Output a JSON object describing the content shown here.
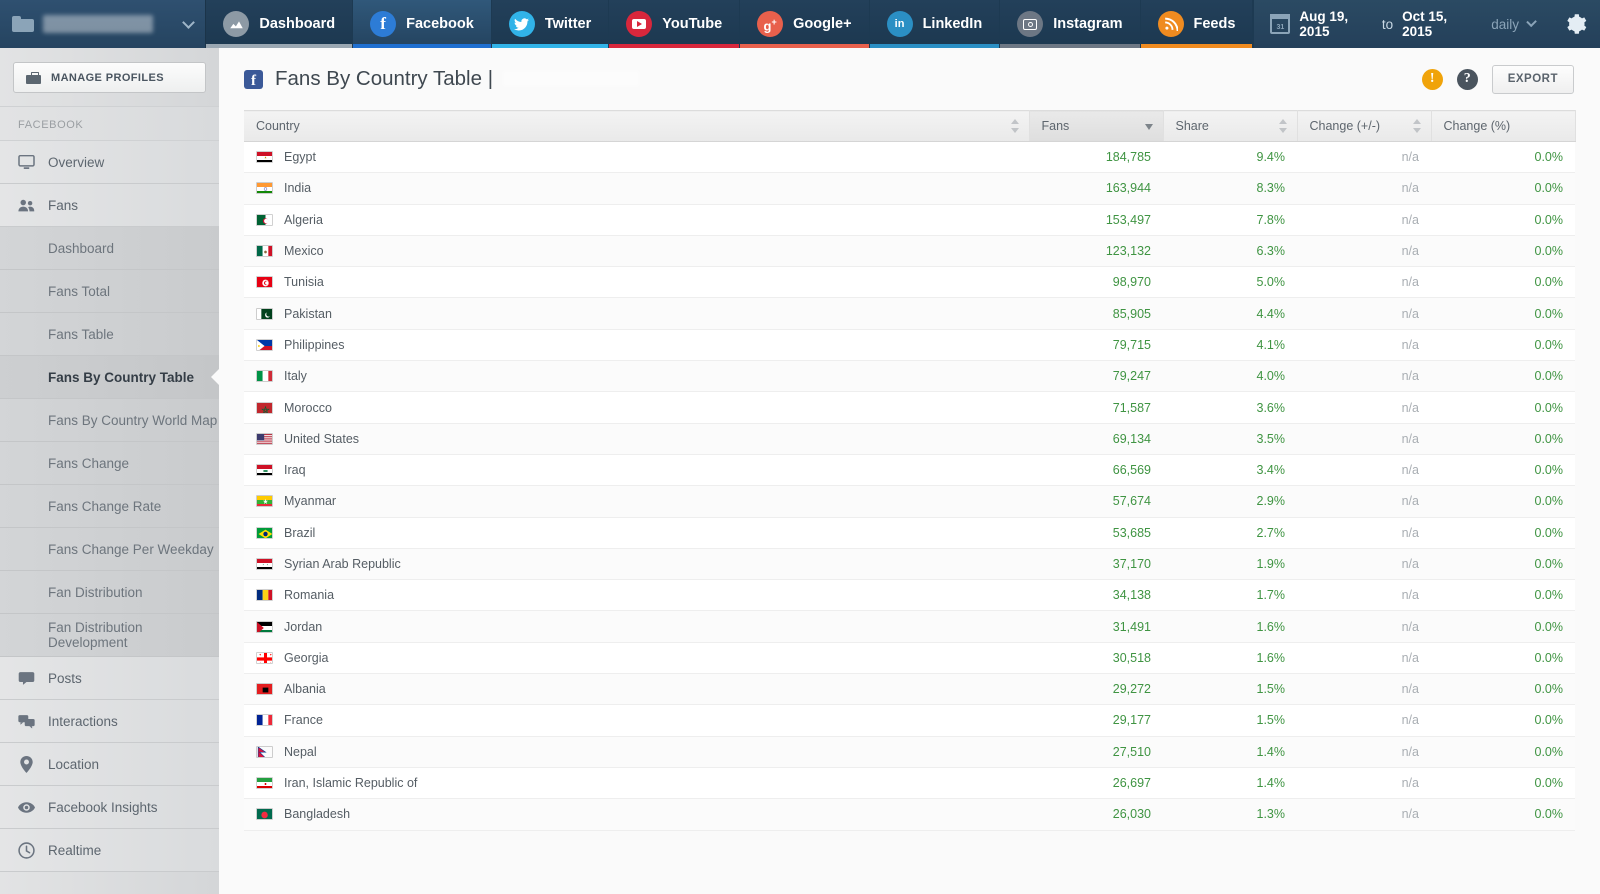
{
  "topbar": {
    "profile_name_redacted": true,
    "folder_icon": "folder-icon",
    "tabs": [
      {
        "label": "Dashboard",
        "icon": "chart-icon",
        "color": "#8d9aa5",
        "accent": "#9aa7b2",
        "active": false
      },
      {
        "label": "Facebook",
        "icon": "facebook-icon",
        "color": "#2d7cd6",
        "accent": "#1f6fd0",
        "active": true
      },
      {
        "label": "Twitter",
        "icon": "twitter-icon",
        "color": "#31b3e8",
        "accent": "#31b3e8",
        "active": false
      },
      {
        "label": "YouTube",
        "icon": "youtube-icon",
        "color": "#d8273c",
        "accent": "#d8273c",
        "active": false
      },
      {
        "label": "Google+",
        "icon": "googleplus-icon",
        "color": "#e8604c",
        "accent": "#e8604c",
        "active": false
      },
      {
        "label": "LinkedIn",
        "icon": "linkedin-icon",
        "color": "#2b8fc4",
        "accent": "#2b8fc4",
        "active": false
      },
      {
        "label": "Instagram",
        "icon": "instagram-icon",
        "color": "#6d7784",
        "accent": "#6d7784",
        "active": false
      },
      {
        "label": "Feeds",
        "icon": "rss-icon",
        "color": "#ef8b20",
        "accent": "#ef8b20",
        "active": false
      }
    ],
    "date_range": {
      "calendar_icon": "calendar-icon",
      "calendar_day": "31",
      "start": "Aug 19, 2015",
      "to_label": "to",
      "end": "Oct 15, 2015",
      "granularity": "daily"
    },
    "settings_icon": "gear-icon"
  },
  "sidebar": {
    "manage_profiles": "MANAGE PROFILES",
    "section_label": "FACEBOOK",
    "items": [
      {
        "label": "Overview",
        "icon": "monitor-icon",
        "type": "top"
      },
      {
        "label": "Fans",
        "icon": "users-icon",
        "type": "top"
      },
      {
        "label": "Dashboard",
        "type": "sub",
        "active": false
      },
      {
        "label": "Fans Total",
        "type": "sub",
        "active": false
      },
      {
        "label": "Fans Table",
        "type": "sub",
        "active": false
      },
      {
        "label": "Fans By Country Table",
        "type": "sub",
        "active": true
      },
      {
        "label": "Fans By Country World Map",
        "type": "sub",
        "active": false
      },
      {
        "label": "Fans Change",
        "type": "sub",
        "active": false
      },
      {
        "label": "Fans Change Rate",
        "type": "sub",
        "active": false
      },
      {
        "label": "Fans Change Per Weekday",
        "type": "sub",
        "active": false
      },
      {
        "label": "Fan Distribution",
        "type": "sub",
        "active": false
      },
      {
        "label": "Fan Distribution Development",
        "type": "sub",
        "active": false
      },
      {
        "label": "Posts",
        "icon": "speech-icon",
        "type": "top"
      },
      {
        "label": "Interactions",
        "icon": "comments-icon",
        "type": "top"
      },
      {
        "label": "Location",
        "icon": "pin-icon",
        "type": "top"
      },
      {
        "label": "Facebook Insights",
        "icon": "eye-icon",
        "type": "top"
      },
      {
        "label": "Realtime",
        "icon": "clock-icon",
        "type": "top"
      }
    ]
  },
  "page": {
    "brand_icon": "facebook-icon",
    "title": "Fans By Country Table |",
    "profile_redacted": true,
    "alert_icon": "warning-icon",
    "alert_color": "#f0a30a",
    "help_icon": "help-icon",
    "help_color": "#4a545e",
    "export_label": "EXPORT"
  },
  "table": {
    "columns": [
      {
        "label": "Country",
        "align": "left",
        "sorted": false
      },
      {
        "label": "Fans",
        "align": "right",
        "sorted": true
      },
      {
        "label": "Share",
        "align": "left",
        "sorted": false
      },
      {
        "label": "Change (+/-)",
        "align": "left",
        "sorted": false
      },
      {
        "label": "Change (%)",
        "align": "left",
        "sorted": false
      }
    ],
    "rows": [
      {
        "country": "Egypt",
        "flag": "eg",
        "fans": "184,785",
        "share": "9.4%",
        "change": "n/a",
        "change_pct": "0.0%"
      },
      {
        "country": "India",
        "flag": "in",
        "fans": "163,944",
        "share": "8.3%",
        "change": "n/a",
        "change_pct": "0.0%"
      },
      {
        "country": "Algeria",
        "flag": "dz",
        "fans": "153,497",
        "share": "7.8%",
        "change": "n/a",
        "change_pct": "0.0%"
      },
      {
        "country": "Mexico",
        "flag": "mx",
        "fans": "123,132",
        "share": "6.3%",
        "change": "n/a",
        "change_pct": "0.0%"
      },
      {
        "country": "Tunisia",
        "flag": "tn",
        "fans": "98,970",
        "share": "5.0%",
        "change": "n/a",
        "change_pct": "0.0%"
      },
      {
        "country": "Pakistan",
        "flag": "pk",
        "fans": "85,905",
        "share": "4.4%",
        "change": "n/a",
        "change_pct": "0.0%"
      },
      {
        "country": "Philippines",
        "flag": "ph",
        "fans": "79,715",
        "share": "4.1%",
        "change": "n/a",
        "change_pct": "0.0%"
      },
      {
        "country": "Italy",
        "flag": "it",
        "fans": "79,247",
        "share": "4.0%",
        "change": "n/a",
        "change_pct": "0.0%"
      },
      {
        "country": "Morocco",
        "flag": "ma",
        "fans": "71,587",
        "share": "3.6%",
        "change": "n/a",
        "change_pct": "0.0%"
      },
      {
        "country": "United States",
        "flag": "us",
        "fans": "69,134",
        "share": "3.5%",
        "change": "n/a",
        "change_pct": "0.0%"
      },
      {
        "country": "Iraq",
        "flag": "iq",
        "fans": "66,569",
        "share": "3.4%",
        "change": "n/a",
        "change_pct": "0.0%"
      },
      {
        "country": "Myanmar",
        "flag": "mm",
        "fans": "57,674",
        "share": "2.9%",
        "change": "n/a",
        "change_pct": "0.0%"
      },
      {
        "country": "Brazil",
        "flag": "br",
        "fans": "53,685",
        "share": "2.7%",
        "change": "n/a",
        "change_pct": "0.0%"
      },
      {
        "country": "Syrian Arab Republic",
        "flag": "sy",
        "fans": "37,170",
        "share": "1.9%",
        "change": "n/a",
        "change_pct": "0.0%"
      },
      {
        "country": "Romania",
        "flag": "ro",
        "fans": "34,138",
        "share": "1.7%",
        "change": "n/a",
        "change_pct": "0.0%"
      },
      {
        "country": "Jordan",
        "flag": "jo",
        "fans": "31,491",
        "share": "1.6%",
        "change": "n/a",
        "change_pct": "0.0%"
      },
      {
        "country": "Georgia",
        "flag": "ge",
        "fans": "30,518",
        "share": "1.6%",
        "change": "n/a",
        "change_pct": "0.0%"
      },
      {
        "country": "Albania",
        "flag": "al",
        "fans": "29,272",
        "share": "1.5%",
        "change": "n/a",
        "change_pct": "0.0%"
      },
      {
        "country": "France",
        "flag": "fr",
        "fans": "29,177",
        "share": "1.5%",
        "change": "n/a",
        "change_pct": "0.0%"
      },
      {
        "country": "Nepal",
        "flag": "np",
        "fans": "27,510",
        "share": "1.4%",
        "change": "n/a",
        "change_pct": "0.0%"
      },
      {
        "country": "Iran, Islamic Republic of",
        "flag": "ir",
        "fans": "26,697",
        "share": "1.4%",
        "change": "n/a",
        "change_pct": "0.0%"
      },
      {
        "country": "Bangladesh",
        "flag": "bd",
        "fans": "26,030",
        "share": "1.3%",
        "change": "n/a",
        "change_pct": "0.0%"
      }
    ]
  }
}
